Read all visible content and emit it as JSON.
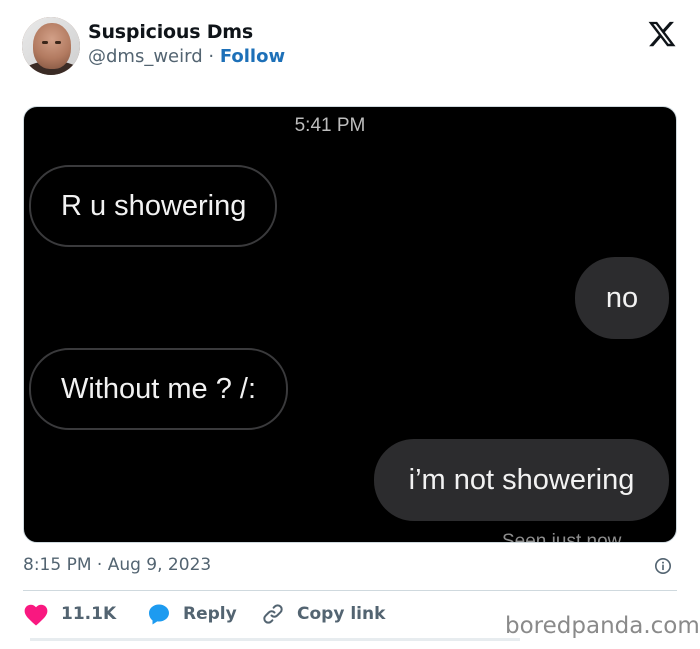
{
  "tweet": {
    "author": {
      "display_name": "Suspicious Dms",
      "handle": "@dms_weird",
      "separator": " · ",
      "follow_label": "Follow"
    },
    "brand_icon": "x-logo-icon",
    "media": {
      "timestamp": "5:41 PM",
      "messages": [
        {
          "side": "incoming",
          "text": "R u showering"
        },
        {
          "side": "outgoing",
          "text": "no"
        },
        {
          "side": "incoming",
          "text": "Without me ? /:"
        },
        {
          "side": "outgoing",
          "text": "i’m not showering"
        }
      ],
      "status": "Seen just now"
    },
    "posted_time": "8:15 PM · Aug 9, 2023",
    "info_icon": "info-icon",
    "actions": {
      "like_count": "11.1K",
      "reply_label": "Reply",
      "copy_link_label": "Copy link"
    },
    "colors": {
      "follow": "#1d70b8",
      "like": "#f91880",
      "reply": "#1d9bf0",
      "text_secondary": "#536471"
    }
  },
  "watermark": "boredpanda.com"
}
